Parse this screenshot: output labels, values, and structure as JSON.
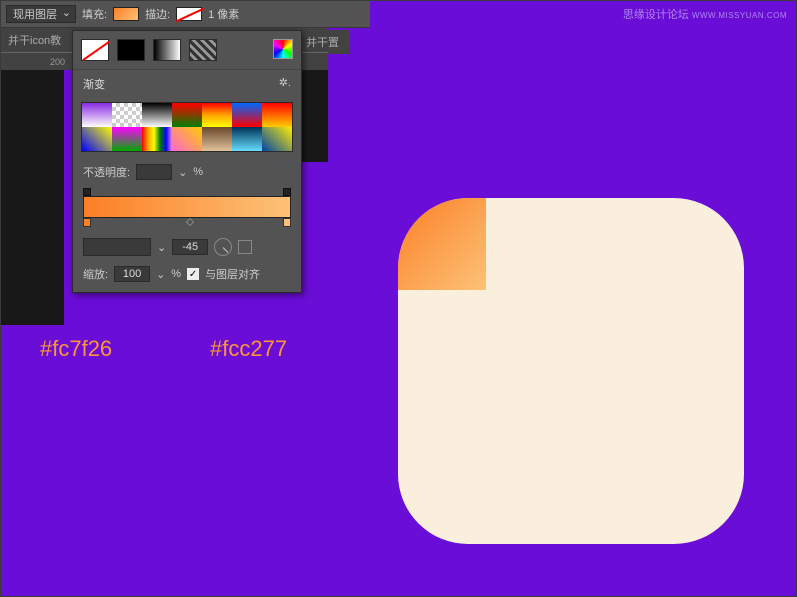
{
  "toolbar": {
    "layer_mode": "现用图层",
    "fill_label": "填充:",
    "stroke_label": "描边:",
    "stroke_width": "1 像素"
  },
  "tab": {
    "left": "并干icon教",
    "right": "并干置"
  },
  "ruler": {
    "tick": "200"
  },
  "gradient": {
    "section_title": "渐变",
    "opacity_label": "不透明度:",
    "percent": "%",
    "angle_value": "-45",
    "scale_label": "缩放:",
    "scale_value": "100",
    "align_label": "与图层对齐"
  },
  "hex": {
    "c1": "#fc7f26",
    "c2": "#fcc277"
  },
  "watermark": {
    "cn": "思缘设计论坛",
    "en": "WWW.MISSYUAN.COM"
  },
  "chart_data": {
    "type": "gradient",
    "angle": -45,
    "stops": [
      {
        "pos": 0,
        "color": "#fc7f26"
      },
      {
        "pos": 100,
        "color": "#fcc277"
      }
    ],
    "scale": 100
  }
}
